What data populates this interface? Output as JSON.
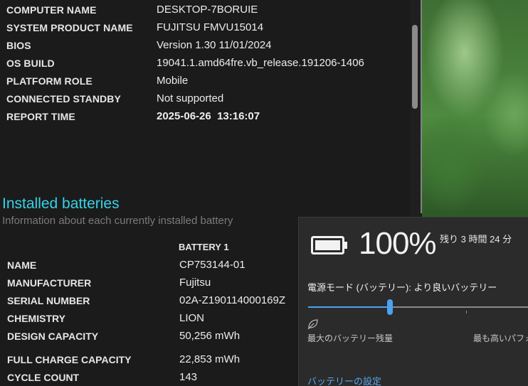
{
  "system": {
    "rows": [
      {
        "key": "COMPUTER NAME",
        "value": "DESKTOP-7BORUIE"
      },
      {
        "key": "SYSTEM PRODUCT NAME",
        "value": "FUJITSU FMVU15014"
      },
      {
        "key": "BIOS",
        "value": "Version 1.30 11/01/2024"
      },
      {
        "key": "OS BUILD",
        "value": "19041.1.amd64fre.vb_release.191206-1406"
      },
      {
        "key": "PLATFORM ROLE",
        "value": "Mobile"
      },
      {
        "key": "CONNECTED STANDBY",
        "value": "Not supported"
      },
      {
        "key": "REPORT TIME",
        "value": "2025-06-26  13:16:07"
      }
    ]
  },
  "installed_batteries": {
    "title": "Installed batteries",
    "subtitle": "Information about each currently installed battery",
    "column_header": "BATTERY 1",
    "rows": [
      {
        "key": "NAME",
        "value": "CP753144-01"
      },
      {
        "key": "MANUFACTURER",
        "value": "Fujitsu"
      },
      {
        "key": "SERIAL NUMBER",
        "value": "02A-Z190114000169Z"
      },
      {
        "key": "CHEMISTRY",
        "value": "LION"
      },
      {
        "key": "DESIGN CAPACITY",
        "value": "50,256 mWh"
      },
      {
        "key": "FULL CHARGE CAPACITY",
        "value": "22,853 mWh"
      },
      {
        "key": "CYCLE COUNT",
        "value": "143"
      }
    ]
  },
  "flyout": {
    "percent": "100%",
    "charge_fraction": 1.0,
    "remaining": "残り 3 時間 24 分",
    "power_mode": "電源モード (バッテリー): より良いバッテリー",
    "slider_position_fraction": 0.36,
    "label_left": "最大のバッテリー残量",
    "label_right": "最も高いパフォーマ",
    "settings_link": "バッテリーの設定"
  },
  "colors": {
    "accent_cyan": "#35d3e8",
    "slider_blue": "#4aa3f0",
    "link_blue": "#5aa9f0"
  },
  "icons": [
    "battery-icon",
    "leaf-icon"
  ]
}
